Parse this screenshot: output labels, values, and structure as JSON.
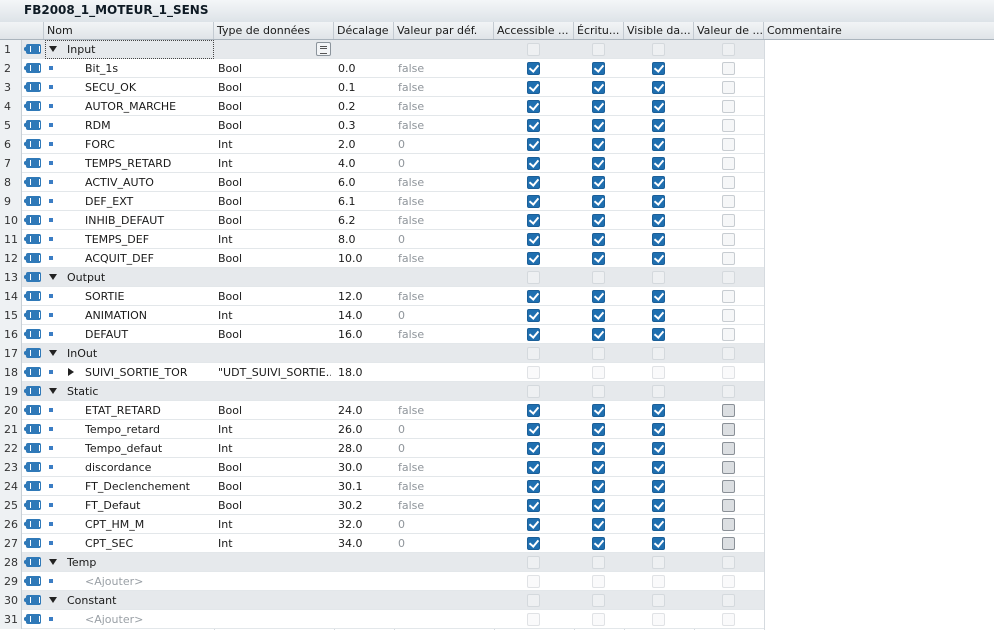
{
  "window_title": "FB2008_1_MOTEUR_1_SENS",
  "columns": [
    "Nom",
    "Type de données",
    "Décalage",
    "Valeur par déf.",
    "Accessible ...",
    "Écritu...",
    "Visible da...",
    "Valeur de ...",
    "Commentaire"
  ],
  "rows": [
    {
      "n": "1",
      "kind": "section",
      "name": "Input",
      "selected": true,
      "flags": [
        "e",
        "e",
        "e",
        "e"
      ]
    },
    {
      "n": "2",
      "kind": "item",
      "name": "Bit_1s",
      "type": "Bool",
      "off": "0.0",
      "def": "false",
      "flags": [
        "c",
        "c",
        "c",
        "e"
      ]
    },
    {
      "n": "3",
      "kind": "item",
      "name": "SECU_OK",
      "type": "Bool",
      "off": "0.1",
      "def": "false",
      "flags": [
        "c",
        "c",
        "c",
        "e"
      ]
    },
    {
      "n": "4",
      "kind": "item",
      "name": "AUTOR_MARCHE",
      "type": "Bool",
      "off": "0.2",
      "def": "false",
      "flags": [
        "c",
        "c",
        "c",
        "e"
      ]
    },
    {
      "n": "5",
      "kind": "item",
      "name": "RDM",
      "type": "Bool",
      "off": "0.3",
      "def": "false",
      "flags": [
        "c",
        "c",
        "c",
        "e"
      ]
    },
    {
      "n": "6",
      "kind": "item",
      "name": "FORC",
      "type": "Int",
      "off": "2.0",
      "def": "0",
      "flags": [
        "c",
        "c",
        "c",
        "e"
      ]
    },
    {
      "n": "7",
      "kind": "item",
      "name": "TEMPS_RETARD",
      "type": "Int",
      "off": "4.0",
      "def": "0",
      "flags": [
        "c",
        "c",
        "c",
        "e"
      ]
    },
    {
      "n": "8",
      "kind": "item",
      "name": "ACTIV_AUTO",
      "type": "Bool",
      "off": "6.0",
      "def": "false",
      "flags": [
        "c",
        "c",
        "c",
        "e"
      ]
    },
    {
      "n": "9",
      "kind": "item",
      "name": "DEF_EXT",
      "type": "Bool",
      "off": "6.1",
      "def": "false",
      "flags": [
        "c",
        "c",
        "c",
        "e"
      ]
    },
    {
      "n": "10",
      "kind": "item",
      "name": "INHIB_DEFAUT",
      "type": "Bool",
      "off": "6.2",
      "def": "false",
      "flags": [
        "c",
        "c",
        "c",
        "e"
      ]
    },
    {
      "n": "11",
      "kind": "item",
      "name": "TEMPS_DEF",
      "type": "Int",
      "off": "8.0",
      "def": "0",
      "flags": [
        "c",
        "c",
        "c",
        "e"
      ]
    },
    {
      "n": "12",
      "kind": "item",
      "name": "ACQUIT_DEF",
      "type": "Bool",
      "off": "10.0",
      "def": "false",
      "flags": [
        "c",
        "c",
        "c",
        "e"
      ]
    },
    {
      "n": "13",
      "kind": "section",
      "name": "Output",
      "flags": [
        "e",
        "e",
        "e",
        "e"
      ]
    },
    {
      "n": "14",
      "kind": "item",
      "name": "SORTIE",
      "type": "Bool",
      "off": "12.0",
      "def": "false",
      "flags": [
        "c",
        "c",
        "c",
        "e"
      ]
    },
    {
      "n": "15",
      "kind": "item",
      "name": "ANIMATION",
      "type": "Int",
      "off": "14.0",
      "def": "0",
      "flags": [
        "c",
        "c",
        "c",
        "e"
      ]
    },
    {
      "n": "16",
      "kind": "item",
      "name": "DEFAUT",
      "type": "Bool",
      "off": "16.0",
      "def": "false",
      "flags": [
        "c",
        "c",
        "c",
        "e"
      ]
    },
    {
      "n": "17",
      "kind": "section",
      "name": "InOut",
      "flags": [
        "e",
        "e",
        "e",
        "e"
      ]
    },
    {
      "n": "18",
      "kind": "struct",
      "name": "SUIVI_SORTIE_TOR",
      "type": "\"UDT_SUIVI_SORTIE...",
      "off": "18.0",
      "def": "",
      "flags": [
        "e",
        "e",
        "e",
        "e"
      ]
    },
    {
      "n": "19",
      "kind": "section",
      "name": "Static",
      "flags": [
        "e",
        "e",
        "e",
        "e"
      ]
    },
    {
      "n": "20",
      "kind": "item",
      "name": "ETAT_RETARD",
      "type": "Bool",
      "off": "24.0",
      "def": "false",
      "flags": [
        "c",
        "c",
        "c",
        "d"
      ]
    },
    {
      "n": "21",
      "kind": "item",
      "name": "Tempo_retard",
      "type": "Int",
      "off": "26.0",
      "def": "0",
      "flags": [
        "c",
        "c",
        "c",
        "d"
      ]
    },
    {
      "n": "22",
      "kind": "item",
      "name": "Tempo_defaut",
      "type": "Int",
      "off": "28.0",
      "def": "0",
      "flags": [
        "c",
        "c",
        "c",
        "d"
      ]
    },
    {
      "n": "23",
      "kind": "item",
      "name": "discordance",
      "type": "Bool",
      "off": "30.0",
      "def": "false",
      "flags": [
        "c",
        "c",
        "c",
        "d"
      ]
    },
    {
      "n": "24",
      "kind": "item",
      "name": "FT_Declenchement",
      "type": "Bool",
      "off": "30.1",
      "def": "false",
      "flags": [
        "c",
        "c",
        "c",
        "d"
      ]
    },
    {
      "n": "25",
      "kind": "item",
      "name": "FT_Defaut",
      "type": "Bool",
      "off": "30.2",
      "def": "false",
      "flags": [
        "c",
        "c",
        "c",
        "d"
      ]
    },
    {
      "n": "26",
      "kind": "item",
      "name": "CPT_HM_M",
      "type": "Int",
      "off": "32.0",
      "def": "0",
      "flags": [
        "c",
        "c",
        "c",
        "d"
      ]
    },
    {
      "n": "27",
      "kind": "item",
      "name": "CPT_SEC",
      "type": "Int",
      "off": "34.0",
      "def": "0",
      "flags": [
        "c",
        "c",
        "c",
        "d"
      ]
    },
    {
      "n": "28",
      "kind": "section",
      "name": "Temp",
      "flags": [
        "e",
        "e",
        "e",
        "e"
      ]
    },
    {
      "n": "29",
      "kind": "add",
      "name": "<Ajouter>",
      "flags": [
        "e",
        "e",
        "e",
        "e"
      ]
    },
    {
      "n": "30",
      "kind": "section",
      "name": "Constant",
      "flags": [
        "e",
        "e",
        "e",
        "e"
      ]
    },
    {
      "n": "31",
      "kind": "add",
      "name": "<Ajouter>",
      "flags": [
        "e",
        "e",
        "e",
        "e"
      ]
    }
  ]
}
